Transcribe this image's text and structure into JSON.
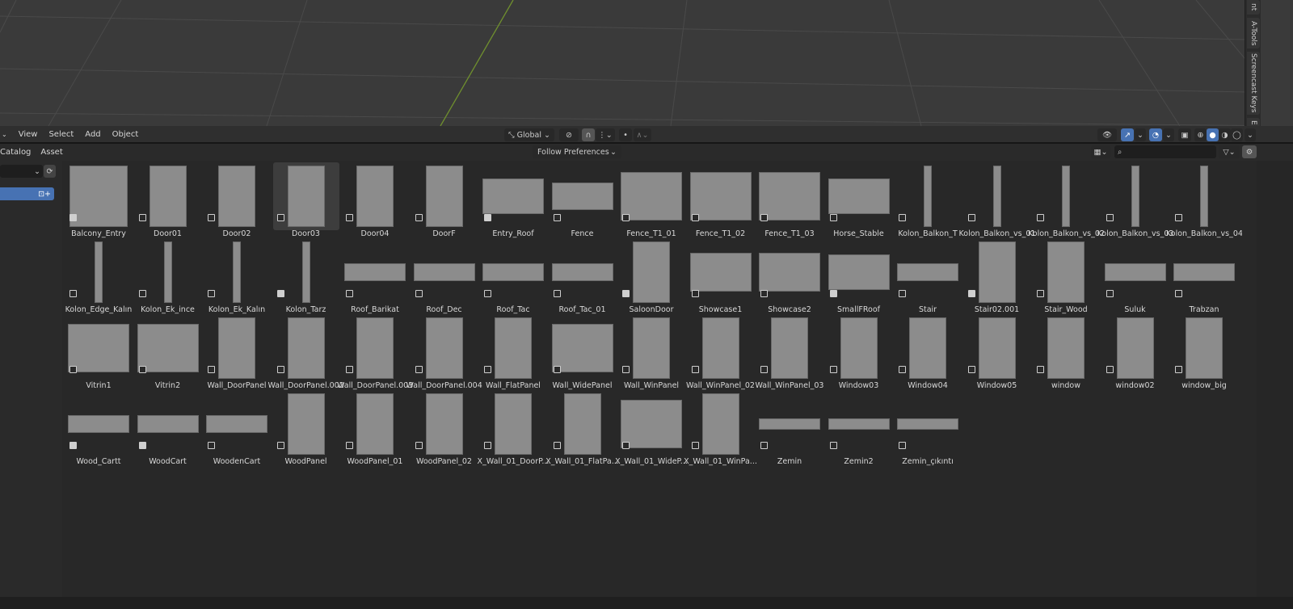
{
  "viewport": {
    "side_tabs": [
      "nt",
      "A-Tools",
      "Screencast Keys",
      "E"
    ]
  },
  "header": {
    "menus": [
      "View",
      "Select",
      "Add",
      "Object"
    ],
    "transform_orientation": "Global"
  },
  "asset_header": {
    "menus": [
      "Catalog",
      "Asset"
    ],
    "import_method": "Follow Preferences",
    "search_placeholder": ""
  },
  "assets": [
    {
      "name": "Balcony_Entry",
      "kind": "balcony",
      "icon": "collection"
    },
    {
      "name": "Door01",
      "kind": "door",
      "icon": "object"
    },
    {
      "name": "Door02",
      "kind": "door",
      "icon": "object"
    },
    {
      "name": "Door03",
      "kind": "door",
      "icon": "object",
      "active": true
    },
    {
      "name": "Door04",
      "kind": "door",
      "icon": "object"
    },
    {
      "name": "DoorF",
      "kind": "door",
      "icon": "object"
    },
    {
      "name": "Entry_Roof",
      "kind": "roof",
      "icon": "collection"
    },
    {
      "name": "Fence",
      "kind": "fence",
      "icon": "object"
    },
    {
      "name": "Fence_T1_01",
      "kind": "panel",
      "icon": "object"
    },
    {
      "name": "Fence_T1_02",
      "kind": "panel",
      "icon": "object"
    },
    {
      "name": "Fence_T1_03",
      "kind": "panel",
      "icon": "object"
    },
    {
      "name": "Horse_Stable",
      "kind": "roof",
      "icon": "object"
    },
    {
      "name": "Kolon_Balkon_T",
      "kind": "pillar",
      "icon": "object"
    },
    {
      "name": "Kolon_Balkon_vs_01",
      "kind": "pillar",
      "icon": "object"
    },
    {
      "name": "Kolon_Balkon_vs_02",
      "kind": "pillar",
      "icon": "object"
    },
    {
      "name": "Kolon_Balkon_vs_03",
      "kind": "pillar",
      "icon": "object"
    },
    {
      "name": "Kolon_Balkon_vs_04",
      "kind": "pillar",
      "icon": "object"
    },
    {
      "name": "Kolon_Edge_Kalın",
      "kind": "pillar",
      "icon": "object"
    },
    {
      "name": "Kolon_Ek_ince",
      "kind": "pillar",
      "icon": "object"
    },
    {
      "name": "Kolon_Ek_Kalın",
      "kind": "pillar",
      "icon": "object"
    },
    {
      "name": "Kolon_Tarz",
      "kind": "pillar",
      "icon": "collection"
    },
    {
      "name": "Roof_Barikat",
      "kind": "low",
      "icon": "object"
    },
    {
      "name": "Roof_Dec",
      "kind": "low",
      "icon": "object"
    },
    {
      "name": "Roof_Tac",
      "kind": "low",
      "icon": "object"
    },
    {
      "name": "Roof_Tac_01",
      "kind": "low",
      "icon": "object"
    },
    {
      "name": "SaloonDoor",
      "kind": "door",
      "icon": "collection"
    },
    {
      "name": "Showcase1",
      "kind": "wide",
      "icon": "object"
    },
    {
      "name": "Showcase2",
      "kind": "wide",
      "icon": "object"
    },
    {
      "name": "SmallFRoof",
      "kind": "roof",
      "icon": "collection"
    },
    {
      "name": "Stair",
      "kind": "low",
      "icon": "object"
    },
    {
      "name": "Stair02.001",
      "kind": "door",
      "icon": "collection"
    },
    {
      "name": "Stair_Wood",
      "kind": "door",
      "icon": "object"
    },
    {
      "name": "Suluk",
      "kind": "low",
      "icon": "object"
    },
    {
      "name": "Trabzan",
      "kind": "low",
      "icon": "object"
    },
    {
      "name": "Vitrin1",
      "kind": "panel",
      "icon": "object"
    },
    {
      "name": "Vitrin2",
      "kind": "panel",
      "icon": "object"
    },
    {
      "name": "Wall_DoorPanel",
      "kind": "door",
      "icon": "object"
    },
    {
      "name": "Wall_DoorPanel.002",
      "kind": "door",
      "icon": "object"
    },
    {
      "name": "Wall_DoorPanel.003",
      "kind": "door",
      "icon": "object"
    },
    {
      "name": "Wall_DoorPanel.004",
      "kind": "door",
      "icon": "object"
    },
    {
      "name": "Wall_FlatPanel",
      "kind": "door",
      "icon": "object"
    },
    {
      "name": "Wall_WidePanel",
      "kind": "panel",
      "icon": "object"
    },
    {
      "name": "Wall_WinPanel",
      "kind": "door",
      "icon": "object"
    },
    {
      "name": "Wall_WinPanel_02",
      "kind": "door",
      "icon": "object"
    },
    {
      "name": "Wall_WinPanel_03",
      "kind": "door",
      "icon": "object"
    },
    {
      "name": "Window03",
      "kind": "door",
      "icon": "object"
    },
    {
      "name": "Window04",
      "kind": "door",
      "icon": "object"
    },
    {
      "name": "Window05",
      "kind": "door",
      "icon": "object"
    },
    {
      "name": "window",
      "kind": "door",
      "icon": "object"
    },
    {
      "name": "window02",
      "kind": "door",
      "icon": "object"
    },
    {
      "name": "window_big",
      "kind": "door",
      "icon": "object"
    },
    {
      "name": "Wood_Cartt",
      "kind": "low",
      "icon": "collection"
    },
    {
      "name": "WoodCart",
      "kind": "low",
      "icon": "collection"
    },
    {
      "name": "WoodenCart",
      "kind": "low",
      "icon": "object"
    },
    {
      "name": "WoodPanel",
      "kind": "door",
      "icon": "object"
    },
    {
      "name": "WoodPanel_01",
      "kind": "door",
      "icon": "object"
    },
    {
      "name": "WoodPanel_02",
      "kind": "door",
      "icon": "object"
    },
    {
      "name": "X_Wall_01_DoorP...",
      "kind": "door",
      "icon": "object"
    },
    {
      "name": "X_Wall_01_FlatPa...",
      "kind": "door",
      "icon": "object"
    },
    {
      "name": "X_Wall_01_WideP...",
      "kind": "panel",
      "icon": "object"
    },
    {
      "name": "X_Wall_01_WinPa...",
      "kind": "door",
      "icon": "object"
    },
    {
      "name": "Zemin",
      "kind": "flat",
      "icon": "object"
    },
    {
      "name": "Zemin2",
      "kind": "flat",
      "icon": "object"
    },
    {
      "name": "Zemin_çıkıntı",
      "kind": "flat",
      "icon": "object"
    }
  ],
  "colors": {
    "accent": "#4772b3",
    "viewport": "#3a3a3a",
    "panel": "#282828"
  }
}
